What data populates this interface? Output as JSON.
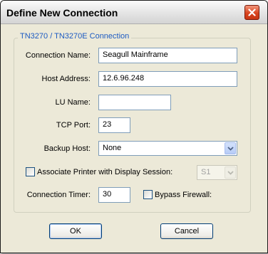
{
  "window": {
    "title": "Define New Connection",
    "close_icon": "close-icon"
  },
  "group": {
    "title": "TN3270 / TN3270E Connection"
  },
  "fields": {
    "connection_name": {
      "label": "Connection Name:",
      "value": "Seagull Mainframe"
    },
    "host_address": {
      "label": "Host Address:",
      "value": "12.6.96.248"
    },
    "lu_name": {
      "label": "LU Name:",
      "value": ""
    },
    "tcp_port": {
      "label": "TCP Port:",
      "value": "23"
    },
    "backup_host": {
      "label": "Backup Host:",
      "value": "None"
    },
    "associate_printer": {
      "label": "Associate Printer with Display Session:",
      "checked": false,
      "select_value": "S1",
      "select_enabled": false
    },
    "connection_timer": {
      "label": "Connection Timer:",
      "value": "30"
    },
    "bypass_firewall": {
      "label": "Bypass Firewall:",
      "checked": false
    }
  },
  "buttons": {
    "ok": "OK",
    "cancel": "Cancel"
  },
  "colors": {
    "group_title": "#1d5bc2",
    "window_bg": "#ece9d8",
    "close_button": "#d9441f"
  }
}
